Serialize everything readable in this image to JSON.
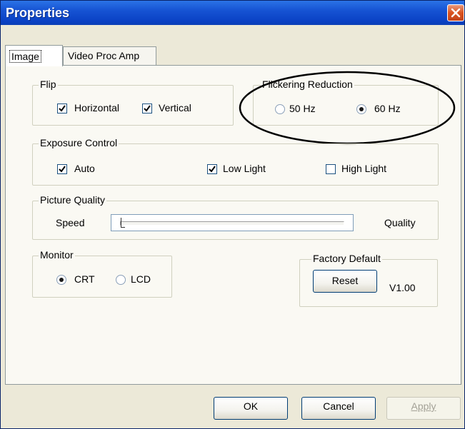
{
  "window": {
    "title": "Properties",
    "close_icon": "close-icon"
  },
  "tabs": [
    {
      "label": "Image",
      "selected": true
    },
    {
      "label": "Video Proc Amp",
      "selected": false
    }
  ],
  "flip": {
    "legend": "Flip",
    "horizontal": {
      "label": "Horizontal",
      "checked": true
    },
    "vertical": {
      "label": "Vertical",
      "checked": true
    }
  },
  "flickering": {
    "legend": "Flickering Reduction",
    "option_50": {
      "label": "50 Hz",
      "selected": false
    },
    "option_60": {
      "label": "60 Hz",
      "selected": true
    }
  },
  "exposure": {
    "legend": "Exposure Control",
    "auto": {
      "label": "Auto",
      "checked": true
    },
    "low_light": {
      "label": "Low Light",
      "checked": true
    },
    "high_light": {
      "label": "High Light",
      "checked": false
    }
  },
  "picture_quality": {
    "legend": "Picture Quality",
    "left_label": "Speed",
    "right_label": "Quality",
    "slider_value": 0
  },
  "monitor": {
    "legend": "Monitor",
    "crt": {
      "label": "CRT",
      "selected": true
    },
    "lcd": {
      "label": "LCD",
      "selected": false
    }
  },
  "factory_default": {
    "legend": "Factory Default",
    "reset_label": "Reset",
    "version": "V1.00"
  },
  "footer": {
    "ok_label": "OK",
    "cancel_label": "Cancel",
    "apply_label": "Apply",
    "apply_enabled": false
  },
  "colors": {
    "title_bar": "#0a41c4",
    "dialog_bg": "#ece9d8",
    "close_button": "#d9521f",
    "annotation_ellipse": "#000000"
  }
}
